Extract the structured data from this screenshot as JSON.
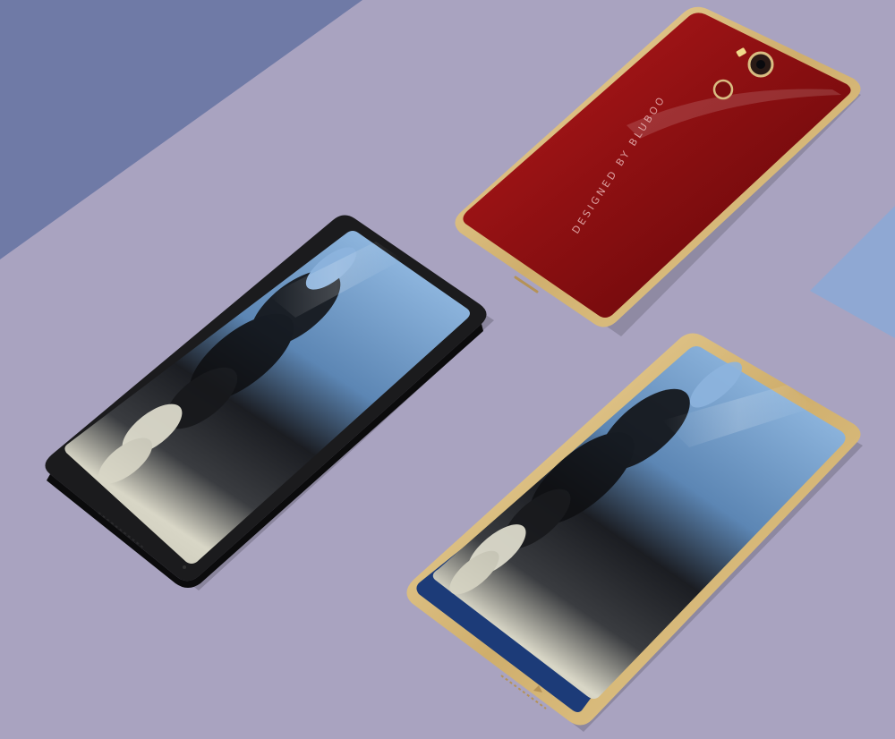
{
  "scene": {
    "background_color": "#a9a3c0",
    "accent_blue_shape_color": "#6f7aa6",
    "accent_light_blue_shape_color": "#8fa8d3"
  },
  "phones": [
    {
      "view": "front",
      "frame_color": "#161618",
      "screen_wallpaper": "ink splash artwork in blue, black and cream"
    },
    {
      "view": "back",
      "body_color": "#8e1012",
      "frame_color": "#d9bd82",
      "engraving": "DESIGNED BY BLUBOO",
      "camera_icon": "camera-lens-icon",
      "fingerprint_icon": "fingerprint-sensor-icon"
    },
    {
      "view": "front",
      "frame_color": "#d9bd82",
      "chin_color": "#1c3b78",
      "screen_wallpaper": "ink splash artwork in blue, black and cream"
    }
  ]
}
